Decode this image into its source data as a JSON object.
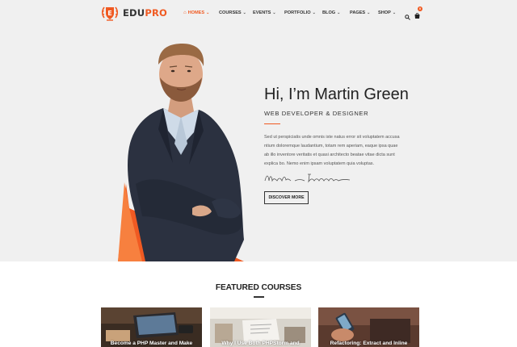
{
  "brand": {
    "name_part1": "EDU",
    "name_part2": "PRO",
    "accent": "#f05a22"
  },
  "nav": {
    "items": [
      {
        "label": "HOMES",
        "active": true,
        "icon": "home-icon"
      },
      {
        "label": "COURSES"
      },
      {
        "label": "EVENTS"
      },
      {
        "label": "PORTFOLIO"
      },
      {
        "label": "BLOG"
      },
      {
        "label": "PAGES"
      },
      {
        "label": "SHOP"
      }
    ],
    "cart_count": "0"
  },
  "hero": {
    "title": "Hi, I’m Martin Green",
    "subtitle": "WEB DEVELOPER & DESIGNER",
    "text_lines": [
      "Sed ut perspiciatis unde omnis iste natus error sit voluptatem accusa",
      "ntium doloremque laudantium, totam rem aperiam, eaque ipsa quae",
      "ab illo inventore veritatis et quasi architecto beatae vitae dicta sunt",
      "explica bo. Nemo enim ipsam voluptatem quia voluptas."
    ],
    "signature": "Martin Freeman",
    "button": "DISCOVER MORE"
  },
  "featured": {
    "title": "FEATURED COURSES",
    "courses": [
      {
        "title": "Become a PHP Master and Make"
      },
      {
        "title": "Why I Use Both PHPStorm and"
      },
      {
        "title": "Refactoring: Extract and Inline"
      }
    ]
  }
}
